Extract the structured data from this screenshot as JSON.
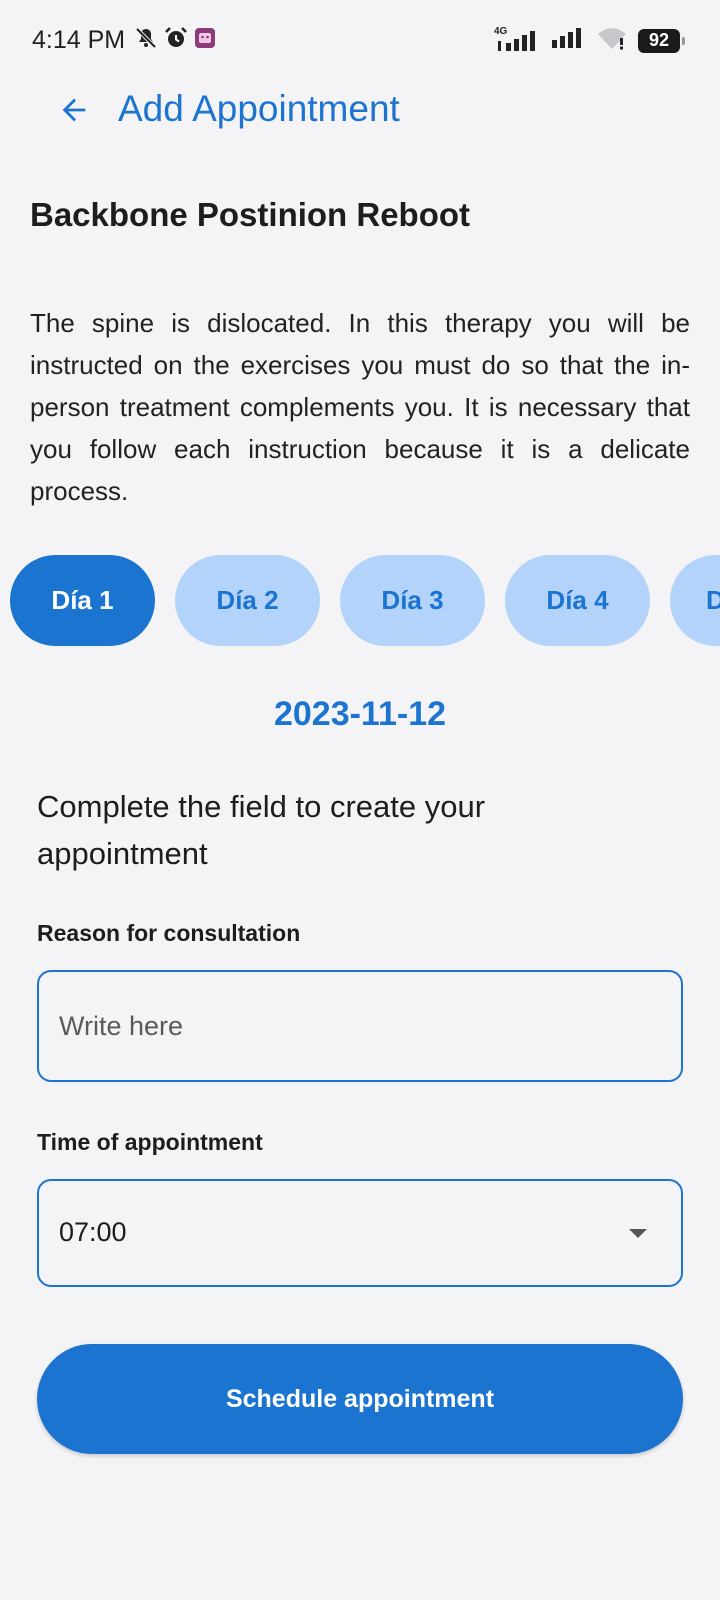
{
  "status_bar": {
    "time": "4:14 PM",
    "network_label": "4G",
    "battery": "92",
    "icons": [
      "notifications-off-icon",
      "alarm-icon",
      "app-notification-icon",
      "signal-icon",
      "signal-icon",
      "wifi-icon",
      "battery-icon"
    ]
  },
  "header": {
    "back_icon": "arrow-left-icon",
    "title": "Add Appointment"
  },
  "therapy": {
    "title": "Backbone Postinion Reboot",
    "description": "The spine is dislocated. In this therapy you will be instructed on the exercises you must do so that the in-person treatment complements you. It is necessary that you follow each instruction because it is a delicate process."
  },
  "days": {
    "items": [
      {
        "label": "Día 1",
        "selected": true
      },
      {
        "label": "Día 2",
        "selected": false
      },
      {
        "label": "Día 3",
        "selected": false
      },
      {
        "label": "Día 4",
        "selected": false
      },
      {
        "label": "D",
        "selected": false
      }
    ]
  },
  "selected_date": "2023-11-12",
  "form": {
    "instruction": "Complete the field to create your appointment",
    "reason_label": "Reason for consultation",
    "reason_placeholder": "Write here",
    "reason_value": "",
    "time_label": "Time of appointment",
    "time_value": "07:00",
    "submit_label": "Schedule appointment"
  },
  "colors": {
    "accent": "#1c74d1",
    "chip_inactive": "#b3d3fb",
    "background": "#f4f4f7"
  }
}
